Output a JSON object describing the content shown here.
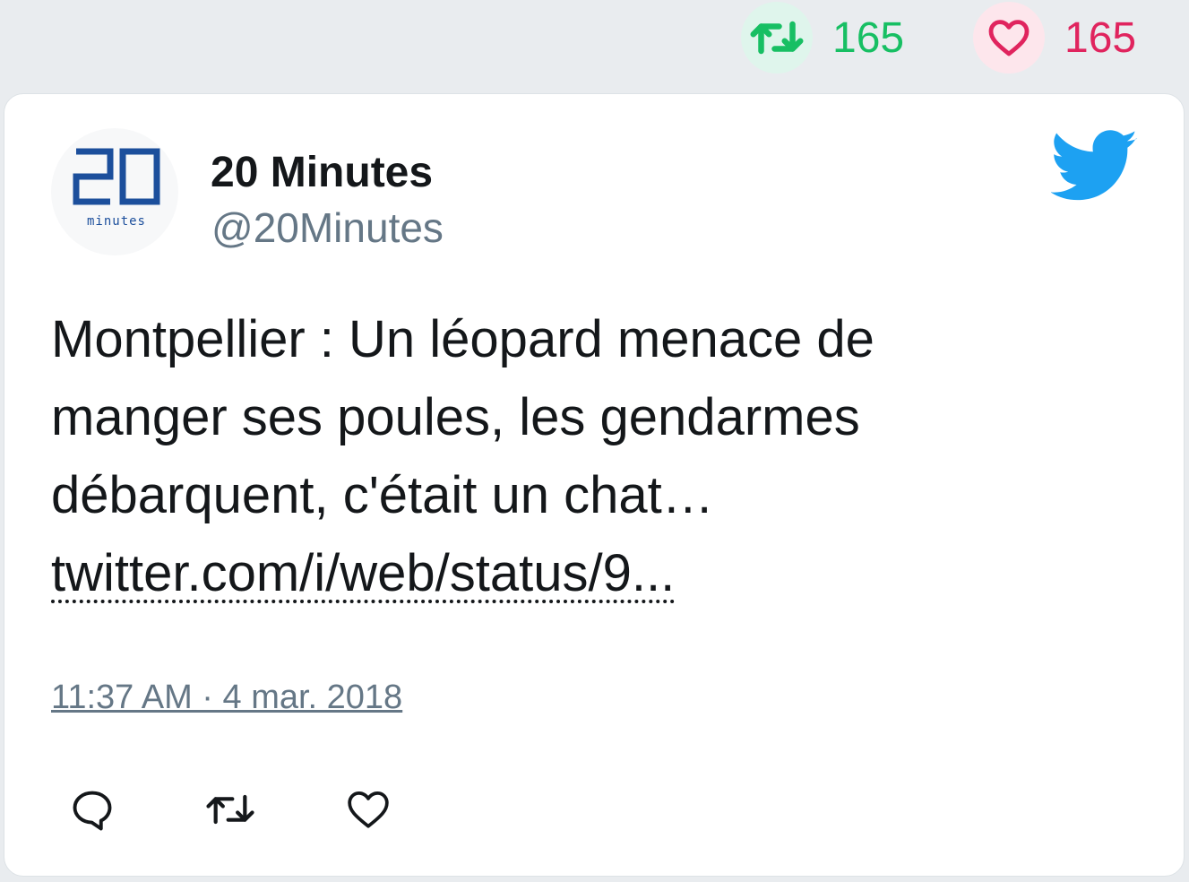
{
  "top_stats": {
    "retweet_count": "165",
    "like_count": "165",
    "retweet_icon": "retweet-icon",
    "like_icon": "heart-icon",
    "colors": {
      "retweet": "#17bf63",
      "like": "#e0245e"
    }
  },
  "tweet": {
    "author_name": "20 Minutes",
    "author_handle": "@20Minutes",
    "avatar_logo": {
      "number": "20",
      "sub": "minutes"
    },
    "text_lines": [
      "Montpellier : Un léopard menace de",
      "manger ses poules, les gendarmes",
      "débarquent, c'était un chat…"
    ],
    "link": "twitter.com/i/web/status/9...",
    "timestamp": "11:37 AM · 4 mar. 2018",
    "platform_icon": "twitter-bird-icon",
    "platform_color": "#1da1f2"
  },
  "actions": [
    {
      "name": "reply",
      "icon": "reply-icon"
    },
    {
      "name": "retweet",
      "icon": "retweet-icon"
    },
    {
      "name": "like",
      "icon": "heart-icon"
    }
  ]
}
